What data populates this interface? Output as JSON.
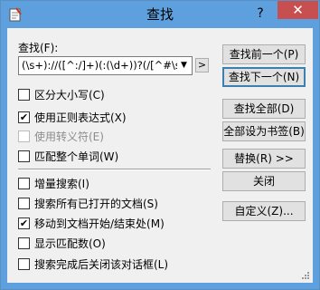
{
  "window": {
    "title": "查找",
    "help_glyph": "?",
    "close_glyph": "✕"
  },
  "find": {
    "label": "查找(F):",
    "value": "(\\s+)://([^:/]+)(:(\\d+))?(/[^#\\s]",
    "more_button": ">"
  },
  "options": [
    {
      "label": "区分大小写(C)",
      "checked": false,
      "disabled": false
    },
    {
      "label": "使用正则表达式(X)",
      "checked": true,
      "disabled": false
    },
    {
      "label": "使用转义符(E)",
      "checked": false,
      "disabled": true
    },
    {
      "label": "匹配整个单词(W)",
      "checked": false,
      "disabled": false
    },
    {
      "label": "增量搜索(I)",
      "checked": false,
      "disabled": false
    },
    {
      "label": "搜索所有已打开的文档(S)",
      "checked": false,
      "disabled": false
    },
    {
      "label": "移动到文档开始/结束处(M)",
      "checked": true,
      "disabled": false
    },
    {
      "label": "显示匹配数(O)",
      "checked": false,
      "disabled": false
    },
    {
      "label": "搜索完成后关闭该对话框(L)",
      "checked": false,
      "disabled": false
    }
  ],
  "buttons": {
    "find_prev": "查找前一个(P)",
    "find_next": "查找下一个(N)",
    "find_all": "查找全部(D)",
    "bookmark_all": "全部设为书签(B)",
    "replace": "替换(R) >>",
    "close": "关闭",
    "customize": "自定义(Z)..."
  },
  "colors": {
    "titlebar": "#5ea0dd",
    "close_button": "#c74f4f",
    "dialog_bg": "#f0f0f0"
  }
}
